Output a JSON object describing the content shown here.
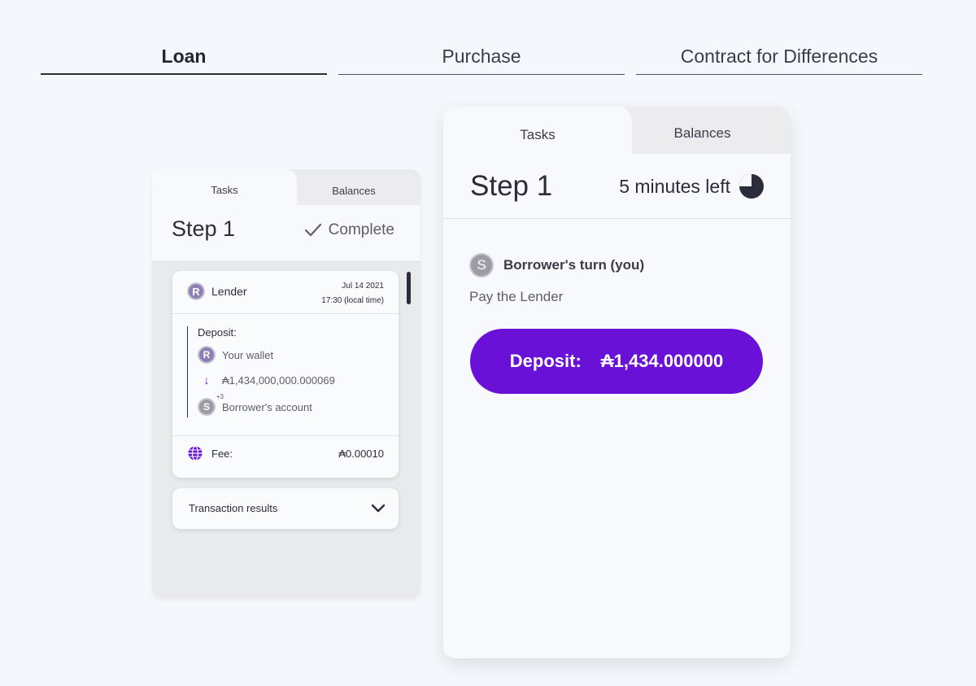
{
  "top_tabs": [
    {
      "label": "Loan",
      "active": true
    },
    {
      "label": "Purchase",
      "active": false
    },
    {
      "label": "Contract for Differences",
      "active": false
    }
  ],
  "small_panel": {
    "tabs": [
      "Tasks",
      "Balances"
    ],
    "step": "Step 1",
    "status": "Complete",
    "lender": {
      "coin_letter": "R",
      "name": "Lender",
      "date": "Jul 14 2021",
      "time": "17:30 (local time)"
    },
    "deposit": {
      "label": "Deposit:",
      "from_coin": "R",
      "from": "Your wallet",
      "amount": "₳1,434,000,000.000069",
      "to_coin": "S",
      "to_badge": "+3",
      "to": "Borrower's account"
    },
    "fee": {
      "label": "Fee:",
      "value": "₳0.00010"
    },
    "transaction_results": "Transaction results"
  },
  "big_panel": {
    "tabs": [
      "Tasks",
      "Balances"
    ],
    "step": "Step 1",
    "time_left": "5 minutes left",
    "turn_coin": "S",
    "turn": "Borrower's turn (you)",
    "instruction": "Pay the Lender",
    "button_label": "Deposit:",
    "button_amount": "₳1,434.000000"
  },
  "colors": {
    "accent": "#6a11d8",
    "background": "#f4f7fb",
    "text": "#2b2e3a"
  },
  "icons": [
    "check-icon",
    "clock-icon",
    "globe-icon",
    "chevron-down-icon",
    "arrow-down-icon"
  ]
}
